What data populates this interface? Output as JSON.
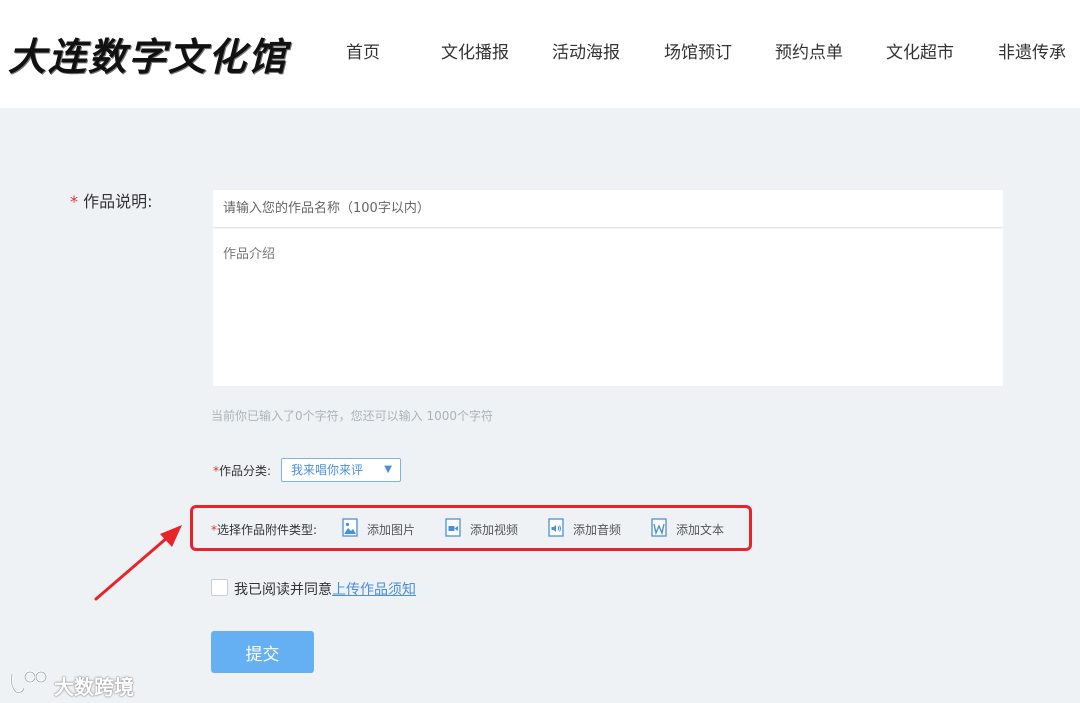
{
  "header": {
    "logo_text": "大连数字文化馆",
    "nav": [
      "首页",
      "文化播报",
      "活动海报",
      "场馆预订",
      "预约点单",
      "文化超市",
      "非遗传承"
    ]
  },
  "form": {
    "required_mark": "*",
    "desc_label": "作品说明:",
    "title_placeholder": "请输入您的作品名称（100字以内）",
    "intro_placeholder": "作品介绍",
    "counter_text": "当前你已输入了0个字符，您还可以输入 1000个字符",
    "category_label": "作品分类:",
    "category_value": "我来唱你来评",
    "attach_label": "选择作品附件类型:",
    "attach_options": [
      {
        "label": "添加图片",
        "icon": "image-icon"
      },
      {
        "label": "添加视频",
        "icon": "video-icon"
      },
      {
        "label": "添加音频",
        "icon": "audio-icon"
      },
      {
        "label": "添加文本",
        "icon": "word-doc-icon"
      }
    ],
    "agree_text": "我已阅读并同意",
    "agree_link": "上传作品须知",
    "submit_label": "提交"
  },
  "colors": {
    "accent": "#4a90d9",
    "submit_bg": "#64b0f2",
    "highlight_red": "#e8232a",
    "page_bg": "#eef2f5"
  },
  "watermark": {
    "text": "大数跨境"
  }
}
